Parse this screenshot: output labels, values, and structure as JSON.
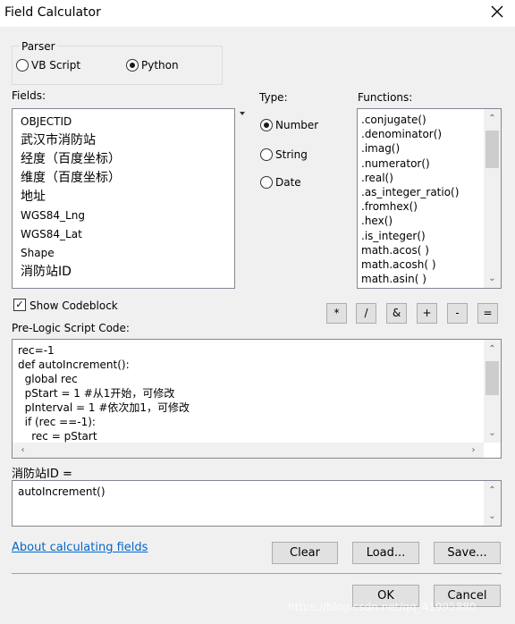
{
  "window": {
    "title": "Field Calculator"
  },
  "parser": {
    "legend": "Parser",
    "options": [
      {
        "label": "VB Script",
        "selected": false
      },
      {
        "label": "Python",
        "selected": true
      }
    ]
  },
  "fields": {
    "label": "Fields:",
    "items": [
      "OBJECTID",
      "武汉市消防站",
      "经度（百度坐标）",
      "维度（百度坐标）",
      "地址",
      "WGS84_Lng",
      "WGS84_Lat",
      "Shape",
      "消防站ID"
    ]
  },
  "type": {
    "label": "Type:",
    "options": [
      {
        "label": "Number",
        "selected": true
      },
      {
        "label": "String",
        "selected": false
      },
      {
        "label": "Date",
        "selected": false
      }
    ]
  },
  "functions": {
    "label": "Functions:",
    "items": [
      ".conjugate()",
      ".denominator()",
      ".imag()",
      ".numerator()",
      ".real()",
      ".as_integer_ratio()",
      ".fromhex()",
      ".hex()",
      ".is_integer()",
      "math.acos( )",
      "math.acosh( )",
      "math.asin( )"
    ]
  },
  "operators": [
    "*",
    "/",
    "&",
    "+",
    "-",
    "="
  ],
  "show_codeblock": {
    "label": "Show Codeblock",
    "checked": true
  },
  "prelogic": {
    "label": "Pre-Logic Script Code:",
    "lines": [
      "rec=-1",
      "def autoIncrement():",
      "  global rec",
      "  pStart = 1 #从1开始，可修改",
      "  pInterval = 1 #依次加1，可修改",
      "  if (rec ==-1):",
      "    rec = pStart"
    ]
  },
  "expression": {
    "label": "消防站ID =",
    "value": "autoIncrement()"
  },
  "link": "About calculating fields",
  "buttons": {
    "clear": "Clear",
    "load": "Load...",
    "save": "Save...",
    "ok": "OK",
    "cancel": "Cancel"
  },
  "watermark": "https://blog.csdn.net/qq_41995880"
}
